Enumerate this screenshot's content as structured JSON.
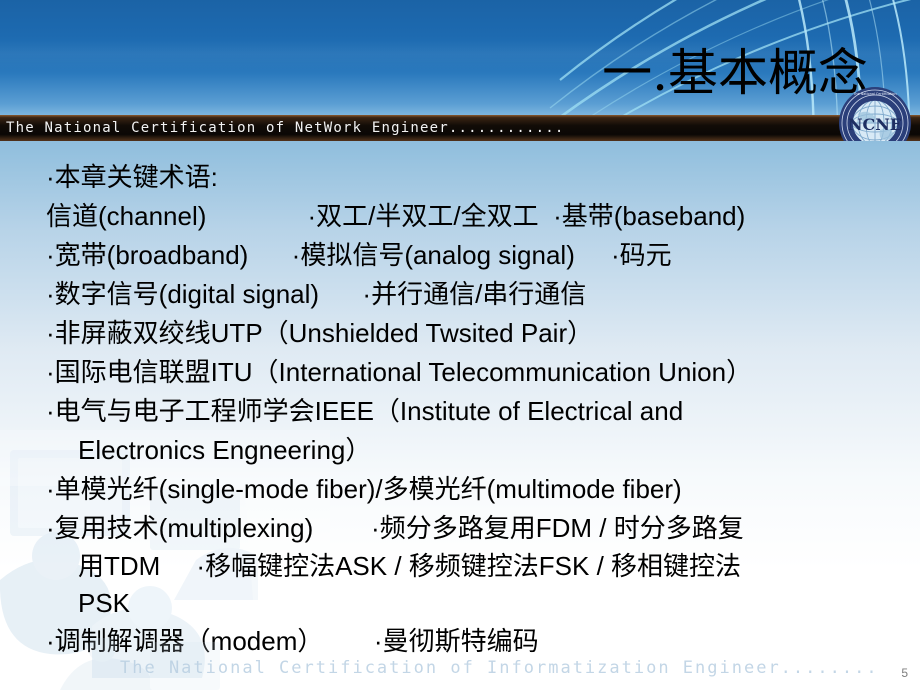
{
  "slide": {
    "title": "一.基本概念",
    "banner_text": "The National Certification of NetWork Engineer............",
    "logo_text": "NCNE",
    "footer_watermark": "The National Certification of Informatization Engineer........",
    "page_number": "5"
  },
  "content": {
    "lines": [
      "·本章关键术语:",
      "信道(channel)              ·双工/半双工/全双工  ·基带(baseband)",
      "·宽带(broadband)      ·模拟信号(analog signal)     ·码元",
      "·数字信号(digital signal)      ·并行通信/串行通信",
      "·非屏蔽双绞线UTP（Unshielded Twsited Pair）",
      "·国际电信联盟ITU（International Telecommunication Union）",
      "·电气与电子工程师学会IEEE（Institute of Electrical and",
      "Electronics Engneering）",
      "·单模光纤(single-mode fiber)/多模光纤(multimode fiber)",
      "·复用技术(multiplexing)        ·频分多路复用FDM / 时分多路复",
      "用TDM     ·移幅键控法ASK / 移频键控法FSK / 移相键控法",
      "PSK",
      "·调制解调器（modem）       ·曼彻斯特编码"
    ]
  },
  "colors": {
    "header_blue": "#1d6ab0",
    "banner_dark": "#120c07",
    "swirl_cyan": "#8fd8f0",
    "text_black": "#000000",
    "body_top_blue": "#8fbedd",
    "footer_watermark": "#b9cfe2"
  }
}
